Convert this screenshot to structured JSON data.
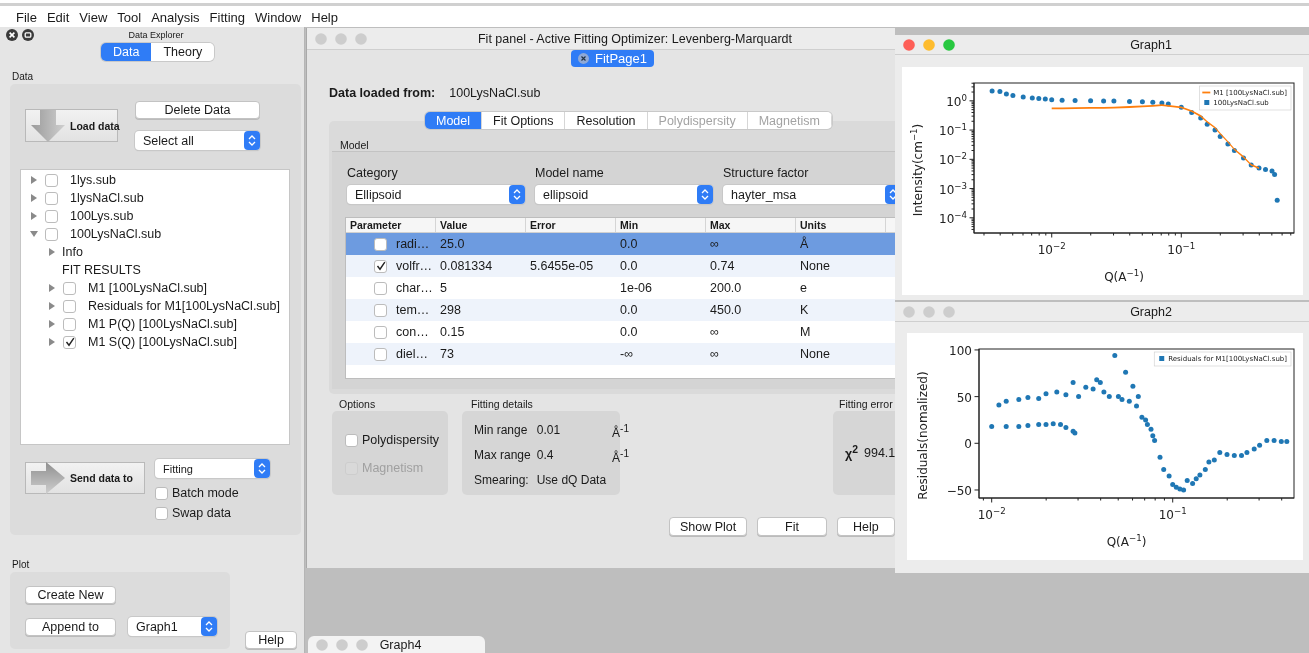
{
  "menu_bar": [
    "File",
    "Edit",
    "View",
    "Tool",
    "Analysis",
    "Fitting",
    "Window",
    "Help"
  ],
  "data_explorer": {
    "title": "Data Explorer",
    "tabs": [
      {
        "label": "Data",
        "selected": true
      },
      {
        "label": "Theory",
        "selected": false
      }
    ],
    "data_group": {
      "title": "Data",
      "load_button": "Load data",
      "delete_button": "Delete Data",
      "select_combo": "Select all",
      "tree": [
        {
          "label": "1lys.sub",
          "expanded": false,
          "checked": false
        },
        {
          "label": "1lysNaCl.sub",
          "expanded": false,
          "checked": false
        },
        {
          "label": "100Lys.sub",
          "expanded": false,
          "checked": false
        },
        {
          "label": "100LysNaCl.sub",
          "expanded": true,
          "checked": false,
          "children": [
            {
              "label": "Info",
              "expanded": false
            },
            {
              "label": "FIT RESULTS"
            },
            {
              "label": "M1 [100LysNaCl.sub]",
              "expanded": false,
              "checked": false
            },
            {
              "label": "Residuals for M1[100LysNaCl.sub]",
              "expanded": false,
              "checked": false
            },
            {
              "label": "M1 P(Q) [100LysNaCl.sub]",
              "expanded": false,
              "checked": false
            },
            {
              "label": "M1 S(Q) [100LysNaCl.sub]",
              "expanded": false,
              "checked": true
            }
          ]
        }
      ],
      "send_button": "Send data to",
      "send_combo": "Fitting",
      "batch_mode": {
        "label": "Batch mode",
        "checked": false
      },
      "swap_data": {
        "label": "Swap data",
        "checked": false
      }
    },
    "plot_group": {
      "title": "Plot",
      "create_button": "Create New",
      "append_button": "Append to",
      "graph_combo": "Graph1"
    },
    "help_button": "Help"
  },
  "fit_panel": {
    "title": "Fit panel - Active Fitting Optimizer: Levenberg-Marquardt",
    "active": false,
    "page_tab": {
      "label": "FitPage1",
      "selected": true
    },
    "data_loaded_label": "Data loaded from:",
    "data_loaded_value": "100LysNaCl.sub",
    "tabs": [
      {
        "label": "Model",
        "selected": true,
        "disabled": false
      },
      {
        "label": "Fit Options",
        "selected": false,
        "disabled": false
      },
      {
        "label": "Resolution",
        "selected": false,
        "disabled": false
      },
      {
        "label": "Polydispersity",
        "selected": false,
        "disabled": true
      },
      {
        "label": "Magnetism",
        "selected": false,
        "disabled": true
      }
    ],
    "model_group": {
      "title": "Model",
      "selectors": [
        {
          "label": "Category",
          "value": "Ellipsoid"
        },
        {
          "label": "Model name",
          "value": "ellipsoid"
        },
        {
          "label": "Structure factor",
          "value": "hayter_msa"
        }
      ],
      "table": {
        "columns": [
          "Parameter",
          "Value",
          "Error",
          "Min",
          "Max",
          "Units"
        ],
        "rows": [
          {
            "selected": true,
            "checked": false,
            "parameter": "radi…",
            "value": "25.0",
            "min": "0.0",
            "max": "∞",
            "units": "Å"
          },
          {
            "selected": false,
            "checked": true,
            "parameter": "volfr…",
            "value": "0.081334",
            "error": "5.6455e-05",
            "min": "0.0",
            "max": "0.74",
            "units": "None"
          },
          {
            "selected": false,
            "checked": false,
            "parameter": "char…",
            "value": "5",
            "min": "1e-06",
            "max": "200.0",
            "units": "e"
          },
          {
            "selected": false,
            "checked": false,
            "parameter": "tem…",
            "value": "298",
            "min": "0.0",
            "max": "450.0",
            "units": "K"
          },
          {
            "selected": false,
            "checked": false,
            "parameter": "con…",
            "value": "0.15",
            "min": "0.0",
            "max": "∞",
            "units": "M"
          },
          {
            "selected": false,
            "checked": false,
            "parameter": "diel…",
            "value": "73",
            "min": "-∞",
            "max": "∞",
            "units": "None"
          }
        ]
      }
    },
    "options": {
      "title": "Options",
      "items": [
        {
          "label": "Polydispersity",
          "checked": false,
          "disabled": false
        },
        {
          "label": "Magnetism",
          "checked": false,
          "disabled": true
        }
      ]
    },
    "fitting_details": {
      "title": "Fitting details",
      "rows": [
        {
          "label": "Min range",
          "value": "0.01",
          "unit": "Å$^{-1}$"
        },
        {
          "label": "Max range",
          "value": "0.4",
          "unit": "Å$^{-1}$"
        },
        {
          "label": "Smearing:",
          "value": "Use dQ Data"
        }
      ]
    },
    "fitting_error": {
      "title": "Fitting error",
      "chi2_label": "χ$^{2}$",
      "chi2_value": "994.1"
    },
    "buttons": [
      "Show Plot",
      "Fit",
      "Help"
    ]
  },
  "graphs": [
    {
      "title": "Graph1",
      "active": true,
      "plot": {
        "xlabel": "Q(A$^{−1}$)",
        "ylabel": "Intensity(cm$^{−1}$)",
        "xtick_labels": [
          "10$^{−2}$",
          "10$^{−1}$"
        ],
        "ytick_labels": [
          "10$^{0}$",
          "10$^{−1}$",
          "10$^{−2}$",
          "10$^{−3}$",
          "10$^{−4}$"
        ],
        "legend": [
          {
            "label": "M1 [100LysNaCl.sub]",
            "kind": "line",
            "color": "#ff7f0e"
          },
          {
            "label": "100LysNaCl.sub",
            "kind": "marker",
            "color": "#1f77b4"
          }
        ]
      }
    },
    {
      "title": "Graph2",
      "active": false,
      "plot": {
        "xlabel": "Q(A$^{−1}$)",
        "ylabel": "Residuals(nomalized)",
        "xtick_labels": [
          "10$^{−2}$",
          "10$^{−1}$"
        ],
        "ytick_labels": [
          "100",
          "50",
          "0",
          "−50"
        ],
        "legend": [
          {
            "label": "Residuals for M1[100LysNaCl.sub]",
            "kind": "marker",
            "color": "#1f77b4"
          }
        ]
      }
    }
  ],
  "minimized_window": {
    "title": "Graph4",
    "active": false
  }
}
